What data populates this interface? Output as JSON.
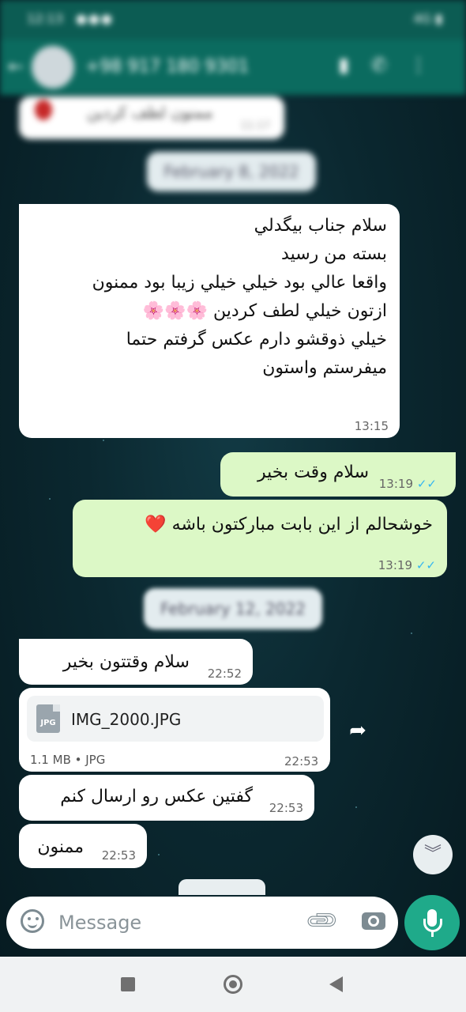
{
  "status_bar": {
    "time": "12:13",
    "indicators": "●●●",
    "system": "4G ▮"
  },
  "header": {
    "contact": "+98 917 180 9301",
    "icons": [
      "video-call-icon",
      "voice-call-icon",
      "more-icon"
    ]
  },
  "messages_top": {
    "old_text": "ممنون لطف کردین",
    "old_time": "11:17",
    "date1": "February 8, 2022"
  },
  "messages": [
    {
      "direction": "in",
      "lines": [
        "سلام جناب بیگدلي",
        "بسته من رسيد",
        "واقعا عالي بود خيلي خيلي زيبا بود ممنون",
        "ازتون خيلي لطف كردين 🌸🌸🌸",
        "خيلي ذوقشو دارم عكس گرفتم حتما",
        "ميفرستم واستون"
      ],
      "time": "13:15"
    },
    {
      "direction": "out",
      "text": "سلام وقت بخير",
      "time": "13:19"
    },
    {
      "direction": "out",
      "text": "خوشحالم از اين بابت مباركتون باشه ❤️",
      "time": "13:19"
    },
    {
      "direction": "in",
      "text": "سلام وقتتون بخير",
      "time": "22:52"
    },
    {
      "direction": "in",
      "type": "file",
      "file_name": "IMG_2000.JPG",
      "file_icon_label": "JPG",
      "file_meta": "1.1 MB • JPG",
      "time": "22:53"
    },
    {
      "direction": "in",
      "text": "گفتين عكس رو ارسال كنم",
      "time": "22:53"
    },
    {
      "direction": "in",
      "text": "ممنون",
      "time": "22:53"
    }
  ],
  "date2": "February 12, 2022",
  "ticks": "✓✓",
  "composer": {
    "placeholder": "Message"
  },
  "colors": {
    "incoming": "#ffffff",
    "outgoing": "#dcf8c6",
    "accent": "#1faa8a",
    "ticks": "#34b7f1"
  }
}
